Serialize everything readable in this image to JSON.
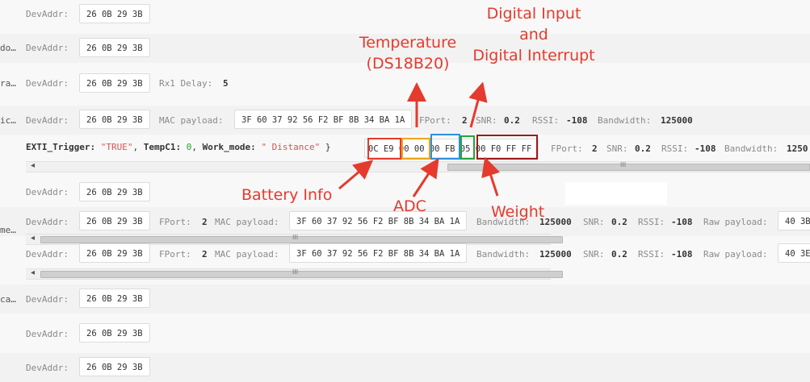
{
  "rows": [
    {
      "prefix": "",
      "label": "DevAddr:",
      "devaddr": "26 0B 29 3B"
    },
    {
      "prefix": "do…",
      "label": "DevAddr:",
      "devaddr": "26 0B 29 3B"
    },
    {
      "prefix": "ra…",
      "label": "DevAddr:",
      "devaddr": "26 0B 29 3B",
      "extra_label": "Rx1 Delay:",
      "extra_value": "5"
    },
    {
      "prefix": "ic…",
      "label": "DevAddr:",
      "devaddr": "26 0B 29 3B",
      "mac_label": "MAC payload:",
      "mac_value": "3F 60 37 92 56 F2 BF 8B 34 BA 1A",
      "fport_label": "FPort:",
      "fport_value": "2",
      "snr_label": "SNR:",
      "snr_value": "0.2",
      "rssi_label": "RSSI:",
      "rssi_value": "-108",
      "bw_label": "Bandwidth:",
      "bw_value": "125000"
    },
    {
      "prefix": "",
      "label": "DevAddr:",
      "devaddr": "26 0B 29 3B"
    },
    {
      "prefix": "me…",
      "label": "DevAddr:",
      "devaddr": "26 0B 29 3B",
      "fport_label": "FPort:",
      "fport_value": "2",
      "mac_label": "MAC payload:",
      "mac_value": "3F 60 37 92 56 F2 BF 8B 34 BA 1A",
      "bw_label": "Bandwidth:",
      "bw_value": "125000",
      "snr_label": "SNR:",
      "snr_value": "0.2",
      "rssi_label": "RSSI:",
      "rssi_value": "-108",
      "raw_label": "Raw payload:",
      "raw_value": "40 3B"
    },
    {
      "prefix": "",
      "label": "DevAddr:",
      "devaddr": "26 0B 29 3B",
      "fport_label": "FPort:",
      "fport_value": "2",
      "mac_label": "MAC payload:",
      "mac_value": "3F 60 37 92 56 F2 BF 8B 34 BA 1A",
      "bw_label": "Bandwidth:",
      "bw_value": "125000",
      "snr_label": "SNR:",
      "snr_value": "0.2",
      "rssi_label": "RSSI:",
      "rssi_value": "-108",
      "raw_label": "Raw payload:",
      "raw_value": "40 3E"
    },
    {
      "prefix": "ca…",
      "label": "DevAddr:",
      "devaddr": "26 0B 29 3B"
    },
    {
      "prefix": "",
      "label": "DevAddr:",
      "devaddr": "26 0B 29 3B"
    },
    {
      "prefix": "",
      "label": "DevAddr:",
      "devaddr": "26 0B 29 3B"
    }
  ],
  "decoded": {
    "k1": "EXTI_Trigger:",
    "v1": "\"TRUE\"",
    "k2": "TempC1:",
    "v2": "0",
    "k3": "Work_mode:",
    "v3": "\" Distance\"",
    "close": "}",
    "payload": "0C E9 00 00 00 FB 05 00 F0 FF FF",
    "fport_label": "FPort:",
    "fport_value": "2",
    "snr_label": "SNR:",
    "snr_value": "0.2",
    "rssi_label": "RSSI:",
    "rssi_value": "-108",
    "bw_label": "Bandwidth:",
    "bw_value": "1250"
  },
  "scroll": {
    "grip": "III",
    "arrow": "◂"
  },
  "annotations": {
    "digital_input": "Digital Input\nand\nDigital Interrupt",
    "temperature": "Temperature\n(DS18B20)",
    "battery": "Battery Info",
    "adc": "ADC",
    "weight": "Weight"
  },
  "colors": {
    "battery": "#e53a2d",
    "temperature": "#f0a417",
    "adc": "#2b8fe3",
    "digital": "#2aa33a",
    "weight": "#9b1b1b",
    "annotation_text": "#e53a2d"
  }
}
